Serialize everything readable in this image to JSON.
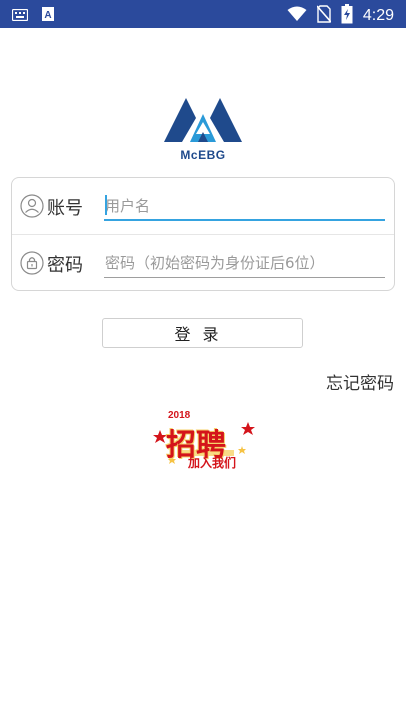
{
  "status_bar": {
    "time": "4:29",
    "left_icons": [
      "keyboard-icon",
      "a-notification-icon"
    ],
    "right_icons": [
      "wifi-icon",
      "no-sim-icon",
      "battery-charging-icon"
    ],
    "color": "#2b4a9c"
  },
  "logo": {
    "text": "McEBG",
    "primary_color": "#1f4a8c",
    "secondary_color": "#2a9ad8"
  },
  "form": {
    "account": {
      "label": "账号",
      "icon": "user-icon",
      "placeholder": "用户名",
      "value": ""
    },
    "password": {
      "label": "密码",
      "icon": "lock-icon",
      "placeholder": "密码（初始密码为身份证后6位）",
      "value": ""
    },
    "accent_color": "#35a3e0"
  },
  "login_button": {
    "label": "登录"
  },
  "forgot_password": {
    "label": "忘记密码"
  },
  "recruit_banner": {
    "title": "招聘",
    "subtitle": "加入我们",
    "year": "2018",
    "color": "#d4141b"
  }
}
